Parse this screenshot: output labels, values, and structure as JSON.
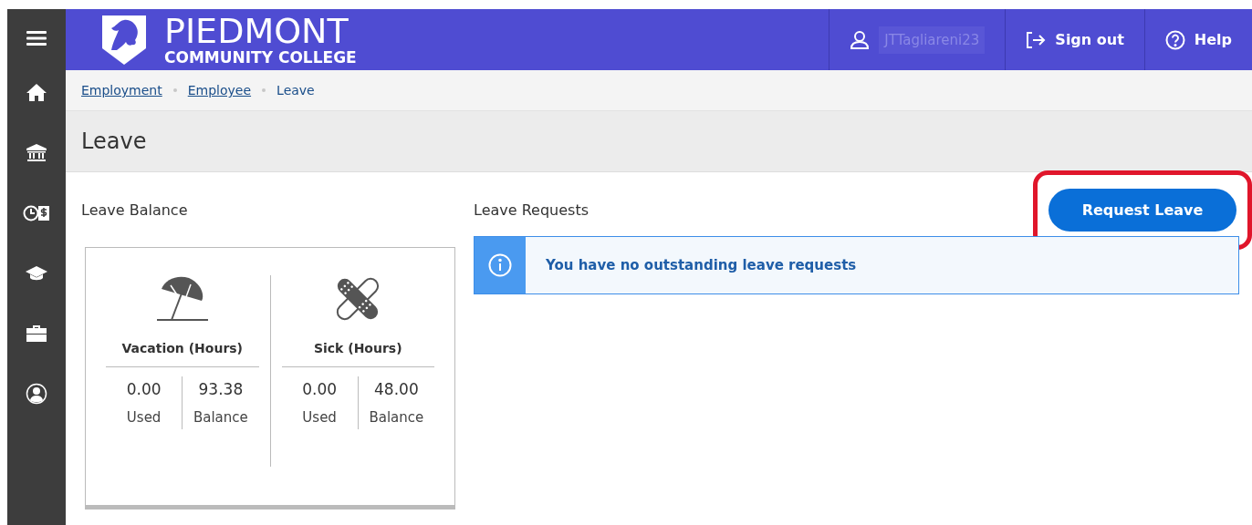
{
  "header": {
    "logo": {
      "title": "PIEDMONT",
      "subtitle": "COMMUNITY COLLEGE"
    },
    "user": {
      "name": "JTTagliareni23"
    },
    "actions": [
      {
        "kind": "signout",
        "label": "Sign out"
      },
      {
        "kind": "help",
        "label": "Help"
      }
    ]
  },
  "sidebar": {
    "items": [
      {
        "kind": "menu"
      },
      {
        "kind": "home"
      },
      {
        "kind": "bank"
      },
      {
        "kind": "timepay"
      },
      {
        "kind": "education"
      },
      {
        "kind": "briefcase"
      },
      {
        "kind": "profile"
      }
    ]
  },
  "breadcrumb": [
    {
      "label": "Employment",
      "link": true
    },
    {
      "label": "Employee",
      "link": true
    },
    {
      "label": "Leave",
      "link": false
    }
  ],
  "page_title": "Leave",
  "leave_balance": {
    "title": "Leave Balance",
    "categories": [
      {
        "kind": "vacation",
        "title": "Vacation (Hours)",
        "used": "0.00",
        "used_label": "Used",
        "balance": "93.38",
        "balance_label": "Balance"
      },
      {
        "kind": "sick",
        "title": "Sick (Hours)",
        "used": "0.00",
        "used_label": "Used",
        "balance": "48.00",
        "balance_label": "Balance"
      }
    ]
  },
  "leave_requests": {
    "title": "Leave Requests",
    "button": {
      "label": "Request Leave",
      "highlighted": true
    },
    "notice": "You have no outstanding leave requests"
  }
}
